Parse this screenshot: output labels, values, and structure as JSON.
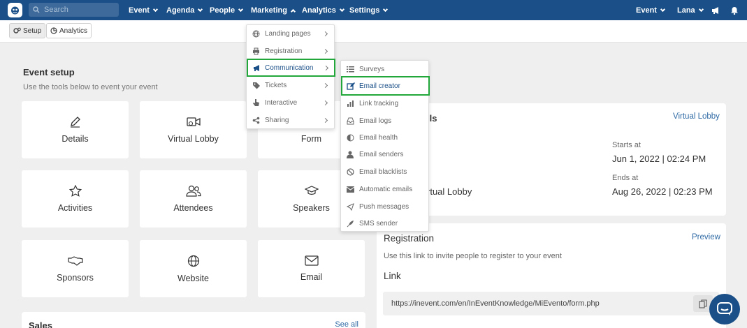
{
  "topbar": {
    "search_placeholder": "Search",
    "nav": [
      {
        "label": "Event"
      },
      {
        "label": "Agenda"
      },
      {
        "label": "People"
      },
      {
        "label": "Marketing"
      },
      {
        "label": "Analytics"
      },
      {
        "label": "Settings"
      }
    ],
    "right_event": "Event",
    "right_user": "Lana"
  },
  "subbar": {
    "setup": "Setup",
    "analytics": "Analytics"
  },
  "page": {
    "title": "Event setup",
    "subtitle": "Use the tools below to event your event"
  },
  "tiles": [
    {
      "label": "Details",
      "icon": "pencil-icon"
    },
    {
      "label": "Virtual Lobby",
      "icon": "video-icon"
    },
    {
      "label": "Form",
      "icon": "form-icon"
    },
    {
      "label": "Activities",
      "icon": "star-icon"
    },
    {
      "label": "Attendees",
      "icon": "users-icon"
    },
    {
      "label": "Speakers",
      "icon": "graduation-cap-icon"
    },
    {
      "label": "Sponsors",
      "icon": "handshake-icon"
    },
    {
      "label": "Website",
      "icon": "globe-icon"
    },
    {
      "label": "Email",
      "icon": "envelope-icon"
    }
  ],
  "sales": {
    "title": "Sales",
    "see_all": "See all"
  },
  "details_card": {
    "title_fragment": "ils",
    "virtual_lobby_link": "Virtual Lobby",
    "starts_label": "Starts at",
    "starts_value": "Jun 1, 2022 | 02:24 PM",
    "ends_label": "Ends at",
    "ends_value": "Aug 26, 2022 | 02:23 PM",
    "location_fragment": "rtual Lobby"
  },
  "registration": {
    "title": "Registration",
    "preview": "Preview",
    "description": "Use this link to invite people to register to your event",
    "link_label": "Link",
    "link_url": "https://inevent.com/en/InEventKnowledge/MiEvento/form.php"
  },
  "marketing_menu": [
    {
      "label": "Landing pages",
      "icon": "globe-icon"
    },
    {
      "label": "Registration",
      "icon": "printer-icon"
    },
    {
      "label": "Communication",
      "icon": "megaphone-icon"
    },
    {
      "label": "Tickets",
      "icon": "tag-icon"
    },
    {
      "label": "Interactive",
      "icon": "hand-pointer-icon"
    },
    {
      "label": "Sharing",
      "icon": "share-icon"
    }
  ],
  "communication_menu": [
    {
      "label": "Surveys",
      "icon": "list-icon"
    },
    {
      "label": "Email creator",
      "icon": "edit-icon"
    },
    {
      "label": "Link tracking",
      "icon": "bar-chart-icon"
    },
    {
      "label": "Email logs",
      "icon": "inbox-icon"
    },
    {
      "label": "Email health",
      "icon": "half-circle-icon"
    },
    {
      "label": "Email senders",
      "icon": "user-icon"
    },
    {
      "label": "Email blacklists",
      "icon": "ban-icon"
    },
    {
      "label": "Automatic emails",
      "icon": "envelope-icon"
    },
    {
      "label": "Push messages",
      "icon": "paper-plane-icon"
    },
    {
      "label": "SMS sender",
      "icon": "rocket-icon"
    }
  ],
  "colors": {
    "primary": "#1a4f87",
    "highlight": "#22a83a",
    "link": "#2f6aa5"
  }
}
